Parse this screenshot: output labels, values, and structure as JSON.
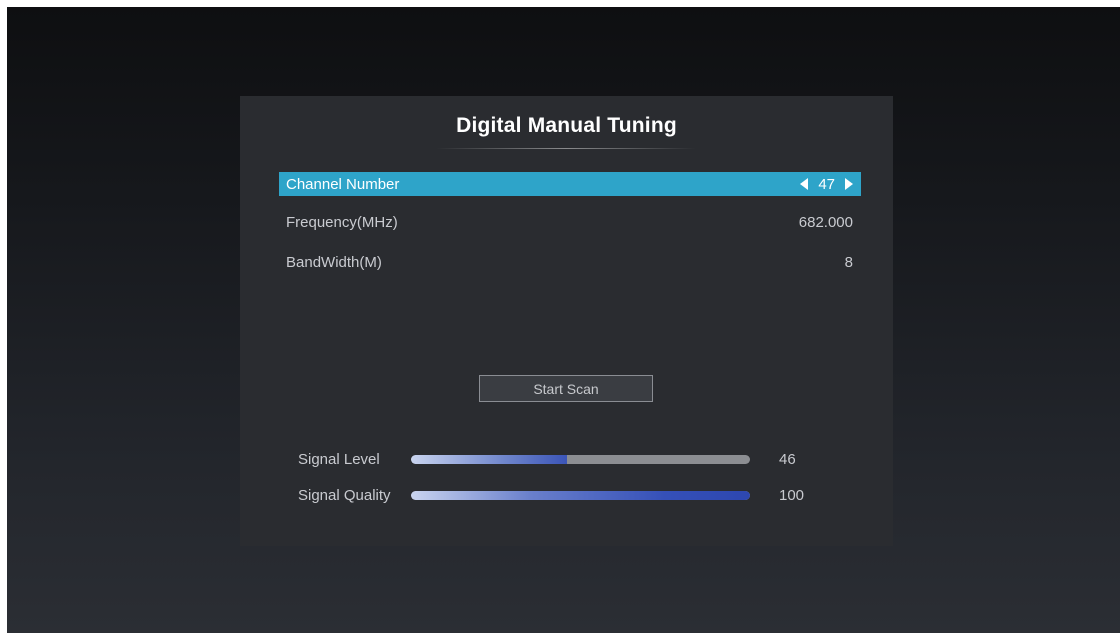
{
  "panel": {
    "title": "Digital Manual Tuning"
  },
  "rows": [
    {
      "label": "Channel Number",
      "value": "47",
      "selected": true
    },
    {
      "label": "Frequency(MHz)",
      "value": "682.000",
      "selected": false
    },
    {
      "label": "BandWidth(M)",
      "value": "8",
      "selected": false
    }
  ],
  "scan_button": {
    "label": "Start Scan"
  },
  "signals": [
    {
      "label": "Signal Level",
      "value": "46",
      "level": 0.46
    },
    {
      "label": "Signal Quality",
      "value": "100",
      "level": 1.0
    }
  ],
  "colors": {
    "highlight": "#2ea4c9",
    "bar_fill": "#3b55b8",
    "bar_track": "#8c8e92"
  },
  "icons": {
    "channel_prev": "triangle-left-icon",
    "channel_next": "triangle-right-icon"
  }
}
